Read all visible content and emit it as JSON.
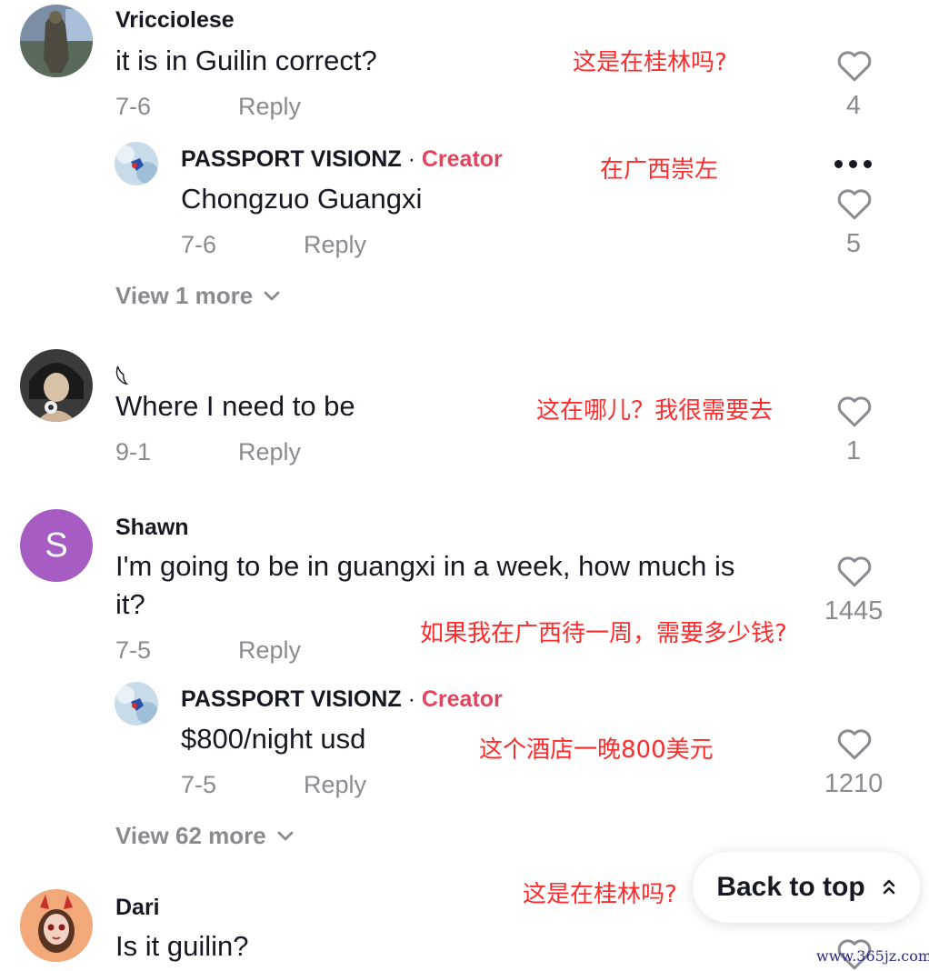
{
  "comments": [
    {
      "username": "Vricciolese",
      "text": "it is in Guilin correct?",
      "date": "7-6",
      "reply_label": "Reply",
      "likes": "4",
      "annotation": "这是在桂林吗?",
      "replies": [
        {
          "username": "PASSPORT VISIONZ",
          "separator": "·",
          "badge": "Creator",
          "text": "Chongzuo Guangxi",
          "date": "7-6",
          "reply_label": "Reply",
          "likes": "5",
          "annotation": "在广西崇左"
        }
      ],
      "view_more": "View 1 more"
    },
    {
      "username": "𓆩",
      "text": "Where I need to be",
      "date": "9-1",
      "reply_label": "Reply",
      "likes": "1",
      "annotation": "这在哪儿？我很需要去"
    },
    {
      "username": "Shawn",
      "avatar_letter": "S",
      "text_line1": "I'm going to be in guangxi in a week, how much is",
      "text_line2": "it?",
      "date": "7-5",
      "reply_label": "Reply",
      "likes": "1445",
      "annotation": "如果我在广西待一周，需要多少钱?",
      "replies": [
        {
          "username": "PASSPORT VISIONZ",
          "separator": "·",
          "badge": "Creator",
          "text": "$800/night usd",
          "date": "7-5",
          "reply_label": "Reply",
          "likes": "1210",
          "annotation": "这个酒店一晚800美元"
        }
      ],
      "view_more": "View 62 more"
    },
    {
      "username": "Dari",
      "text": "Is it guilin?",
      "annotation": "这是在桂林吗?"
    }
  ],
  "back_to_top": "Back to top",
  "watermark": "www.365jz.com",
  "colors": {
    "creator": "#e0455f",
    "annotation": "#fe2c2c",
    "muted": "#8a8b91",
    "shawn_avatar": "#a65cc2"
  },
  "icons": [
    "heart-outline-icon",
    "chevron-down-icon",
    "double-chevron-up-icon",
    "more-horizontal-icon"
  ]
}
